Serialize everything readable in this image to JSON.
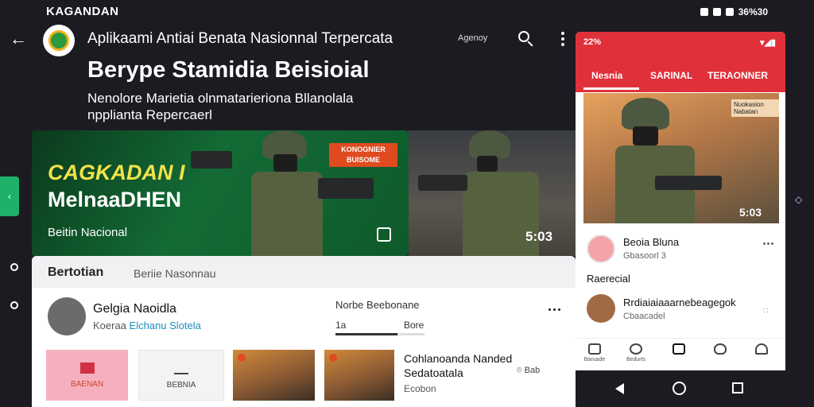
{
  "status_bar": {
    "app_label": "KAGANDAN",
    "indicators": "36%30"
  },
  "header": {
    "app_title": "Aplikaami Antiai Benata Nasionnal Terpercata",
    "agency_label": "Agenoy",
    "headline": "Berype Stamidia Beisioial",
    "sub_line_1": "Nenolore Marietia olnmatarieriona Bllanolala",
    "sub_line_2": "npplianta Repercaerl"
  },
  "hero": {
    "title_1": "CAGKADAN I",
    "title_2": "MelnaaDHEN",
    "subtitle": "Beitin Nacional",
    "badge": "KONOGNIER BUISOME"
  },
  "video_card": {
    "duration": "5:03"
  },
  "panel": {
    "title": "Bertotian",
    "subtitle": "Beriie Nasonnau",
    "user": {
      "name": "Gelgia Naoidla",
      "meta_prefix": "Koeraa",
      "meta_highlight": "Elchanu Slotela"
    },
    "progress": {
      "label": "Norbe Beebonane",
      "left_value": "1a",
      "right_value": "Bore",
      "fraction": 0.7
    },
    "tiles": [
      {
        "label": "BAENAN",
        "icon": "flag-icon"
      },
      {
        "label": "BEBNIA",
        "icon": "chart-icon"
      }
    ],
    "side_title_1": "Cohlanoanda Nanded",
    "side_title_2": "Sedatoatala",
    "side_location": "Bab",
    "side_extra": "Ecobon"
  },
  "phone": {
    "status_left": "22%",
    "tabs": [
      "Nesnia",
      "SARINAL",
      "TERAONNER"
    ],
    "video_badge": "Nuokasion Nabatan",
    "video_duration": "5:03",
    "item1_name": "Beoia Bluna",
    "item1_meta": "Gbasoorl 3",
    "section_label": "Raerecial",
    "item2_name": "Rrdiaiaiaaarnebeagegok",
    "item2_meta": "Cbaacadel",
    "nav_items": [
      "Baruade",
      "Bedurts",
      "",
      "",
      ""
    ]
  },
  "colors": {
    "accent_red": "#e0303a",
    "accent_green": "#1fb06a",
    "highlight_blue": "#1c8fbf"
  }
}
